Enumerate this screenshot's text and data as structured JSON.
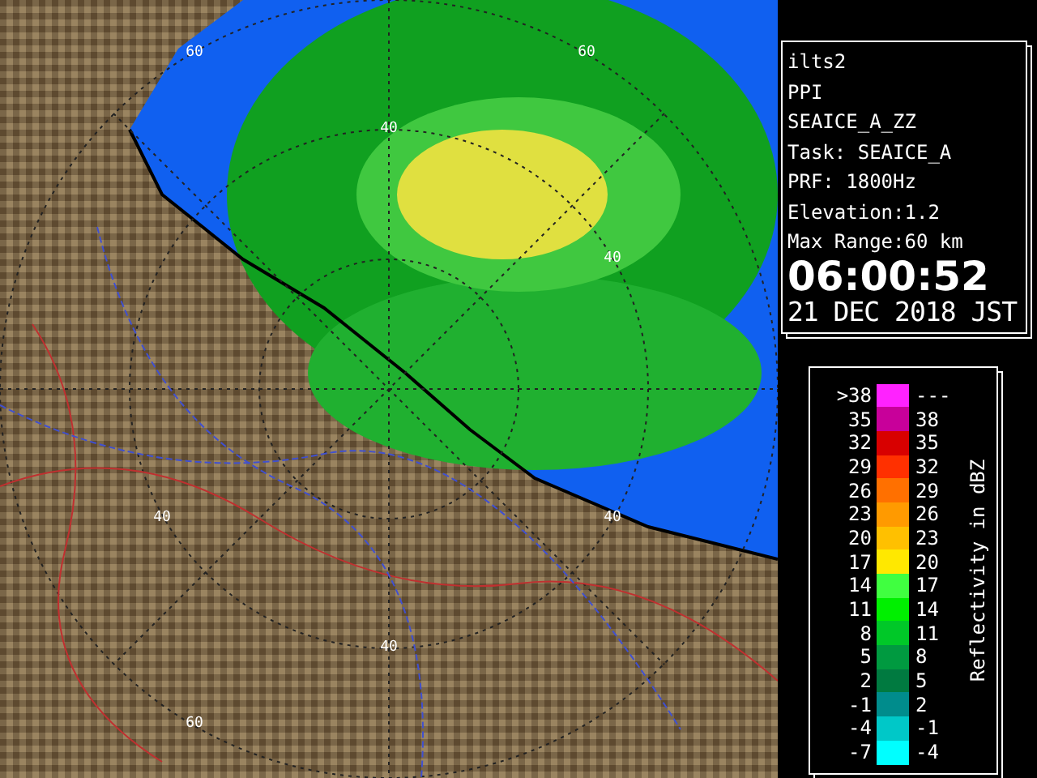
{
  "map": {
    "ring_labels": [
      "60",
      "60",
      "40",
      "40",
      "40",
      "40",
      "40",
      "60"
    ]
  },
  "info": {
    "lines": [
      "ilts2",
      "PPI",
      "SEAICE_A_ZZ",
      "Task: SEAICE_A",
      "PRF: 1800Hz",
      "Elevation:1.2",
      "Max Range:60 km"
    ],
    "time": "06:00:52",
    "date": "21 DEC 2018 JST"
  },
  "legend": {
    "title": "Reflectivity in dBZ",
    "rows": [
      {
        "low": ">38",
        "high": "---",
        "color": "#ff22ff"
      },
      {
        "low": "35",
        "high": "38",
        "color": "#c8009a"
      },
      {
        "low": "32",
        "high": "35",
        "color": "#d80000"
      },
      {
        "low": "29",
        "high": "32",
        "color": "#ff3000"
      },
      {
        "low": "26",
        "high": "29",
        "color": "#ff7000"
      },
      {
        "low": "23",
        "high": "26",
        "color": "#ff9a00"
      },
      {
        "low": "20",
        "high": "23",
        "color": "#ffc000"
      },
      {
        "low": "17",
        "high": "20",
        "color": "#ffe800"
      },
      {
        "low": "14",
        "high": "17",
        "color": "#40ff40"
      },
      {
        "low": "11",
        "high": "14",
        "color": "#00f000"
      },
      {
        "low": "8",
        "high": "11",
        "color": "#00c828"
      },
      {
        "low": "5",
        "high": "8",
        "color": "#009a40"
      },
      {
        "low": "2",
        "high": "5",
        "color": "#007a40"
      },
      {
        "low": "-1",
        "high": "2",
        "color": "#008c8c"
      },
      {
        "low": "-4",
        "high": "-1",
        "color": "#00c8c8"
      },
      {
        "low": "-7",
        "high": "-4",
        "color": "#00ffff"
      }
    ]
  }
}
